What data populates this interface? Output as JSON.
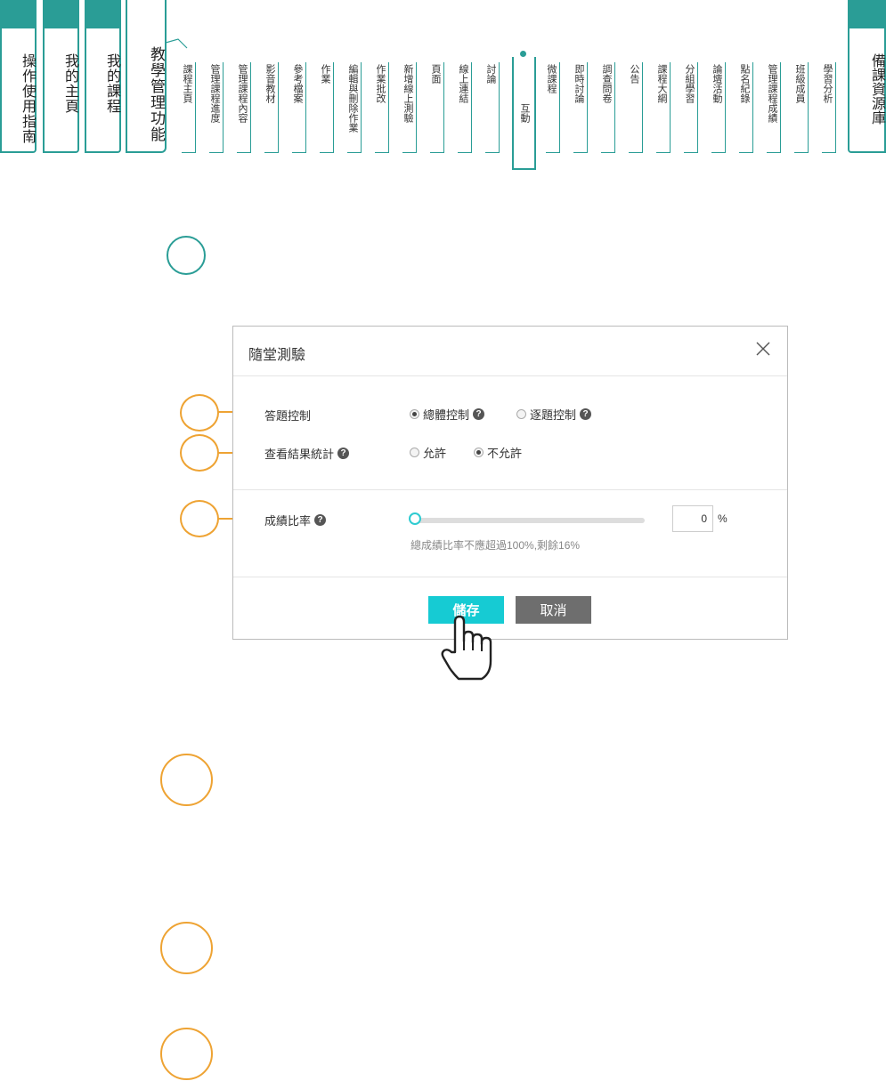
{
  "colors": {
    "teal": "#2a9d96",
    "orange": "#eea333",
    "accent": "#16cbd3",
    "cancel": "#6e6e6e"
  },
  "nav": {
    "main_tabs": [
      "操作使用指南",
      "我的主頁",
      "我的課程"
    ],
    "teaching": "教學管理功能",
    "subtabs": [
      "課程主頁",
      "管理課程進度",
      "管理課程內容",
      "影音教材",
      "參考檔案",
      "作業",
      "編輯與刪除作業",
      "作業批改",
      "新增線上測驗",
      "頁面",
      "線上連結",
      "討論",
      "互動",
      "微課程",
      "即時討論",
      "調查問卷",
      "公告",
      "課程大綱",
      "分組學習",
      "論壇活動",
      "點名紀錄",
      "管理課程成績",
      "班級成員",
      "學習分析"
    ],
    "active_subtab": "互動",
    "resource": "備課資源庫"
  },
  "dialog": {
    "title": "隨堂測驗",
    "close_icon": "close-icon",
    "answer_control": {
      "label": "答題控制",
      "options": [
        "總體控制",
        "逐題控制"
      ],
      "selected": "總體控制"
    },
    "result_stats": {
      "label": "查看結果統計",
      "options": [
        "允許",
        "不允許"
      ],
      "selected": "不允許"
    },
    "grade_ratio": {
      "label": "成績比率",
      "value": "0",
      "slider_fraction": 0,
      "unit": "%",
      "hint": "總成績比率不應超過100%,剩餘16%"
    },
    "save_label": "儲存",
    "cancel_label": "取消"
  }
}
